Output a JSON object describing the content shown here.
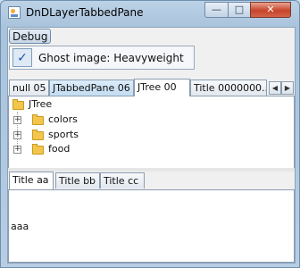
{
  "window": {
    "title": "DnDLayerTabbedPane",
    "controls": {
      "minimize": "—",
      "maximize": "□",
      "close": "✕"
    }
  },
  "menubar": {
    "debug_label": "Debug"
  },
  "ghost_menu_item": {
    "check": "✓",
    "label": "Ghost image: Heavyweight",
    "checked": true
  },
  "top_tabs": [
    {
      "label": "null 05",
      "selected": false
    },
    {
      "label": "JTabbedPane 06",
      "selected": false
    },
    {
      "label": "JTree 00",
      "selected": true
    },
    {
      "label": "Title 0000000...",
      "selected": false
    }
  ],
  "tab_scroll": {
    "left": "◀",
    "right": "▶"
  },
  "tree": {
    "root": "JTree",
    "children": [
      "colors",
      "sports",
      "food"
    ],
    "expander_symbol": "+"
  },
  "bottom_tabs": [
    {
      "label": "Title aa",
      "selected": true
    },
    {
      "label": "Title bb",
      "selected": false
    },
    {
      "label": "Title cc",
      "selected": false
    }
  ],
  "bottom_content": {
    "text": "aaa"
  }
}
